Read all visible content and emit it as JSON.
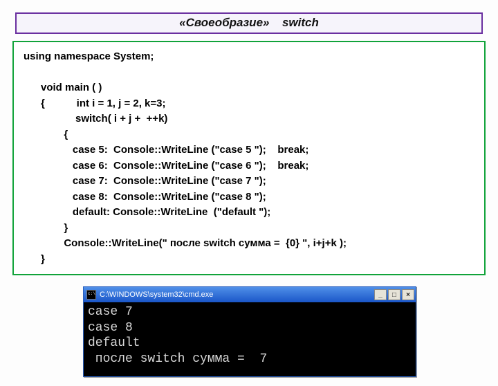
{
  "title": {
    "left": "«Своеобразие»",
    "right": "switch"
  },
  "code": "using namespace System;\n\n      void main ( )\n      {           int i = 1, j = 2, k=3;\n                  switch( i + j +  ++k)\n              {\n                 case 5:  Console::WriteLine (\"case 5 \");    break;\n                 case 6:  Console::WriteLine (\"case 6 \");    break;\n                 case 7:  Console::WriteLine (\"case 7 \");\n                 case 8:  Console::WriteLine (\"case 8 \");\n                 default: Console::WriteLine  (\"default \");\n              }\n              Console::WriteLine(\" после switch сумма =  {0} \", i+j+k );\n      }",
  "console": {
    "title": "C:\\WINDOWS\\system32\\cmd.exe",
    "buttons": {
      "min": "_",
      "max": "□",
      "close": "×"
    },
    "output": "case 7\ncase 8\ndefault\n после switch сумма =  7"
  }
}
